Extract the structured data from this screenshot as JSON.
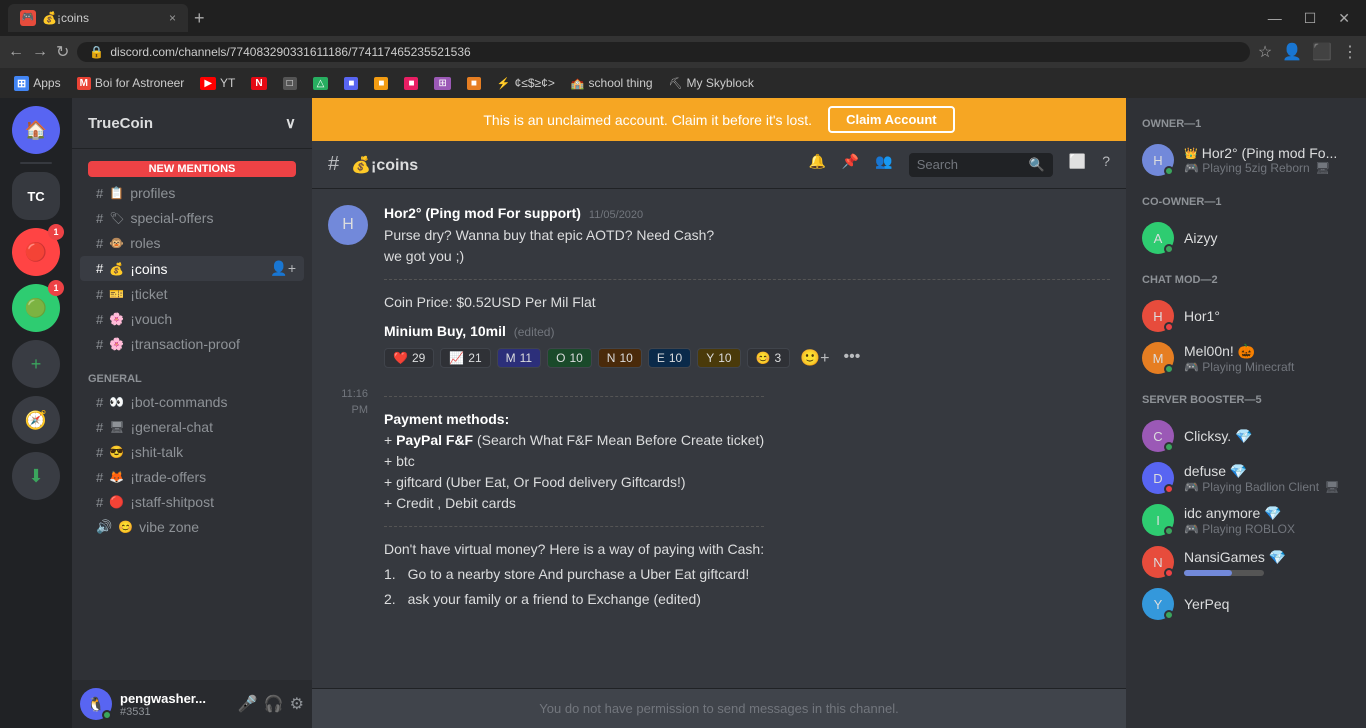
{
  "browser": {
    "tab_favicon": "🎮",
    "tab_title": "💰¡coins",
    "tab_close": "×",
    "nav_back": "←",
    "nav_forward": "→",
    "nav_refresh": "↻",
    "address": "discord.com/channels/774083290331611186/774117465235521536",
    "star_icon": "☆",
    "profile_icon": "👤",
    "menu_icon": "⋮"
  },
  "bookmarks": [
    {
      "label": "Apps",
      "color": "#4285F4",
      "icon": "⋮"
    },
    {
      "label": "Boi for Astroneer",
      "color": "#EA4335",
      "icon": "M"
    },
    {
      "label": "YT",
      "color": "#FF0000",
      "icon": "▶"
    },
    {
      "label": "",
      "color": "#E50914",
      "icon": "N"
    },
    {
      "label": "",
      "color": "#555",
      "icon": "□"
    },
    {
      "label": "",
      "color": "#2ecc71",
      "icon": "△"
    },
    {
      "label": "",
      "color": "#5865F2",
      "icon": "■"
    },
    {
      "label": "",
      "color": "#f39c12",
      "icon": "■"
    },
    {
      "label": "",
      "color": "#e91e63",
      "icon": "■"
    },
    {
      "label": "",
      "color": "#9b59b6",
      "icon": "⊞"
    },
    {
      "label": "",
      "color": "#e67e22",
      "icon": "■"
    },
    {
      "label": "¢≤$≥¢>",
      "color": "#aaa",
      "icon": "⚡"
    },
    {
      "label": "school thing",
      "color": "#aaa",
      "icon": "🏫"
    },
    {
      "label": "My Skyblock",
      "color": "#aaa",
      "icon": "⛏"
    }
  ],
  "server": {
    "name": "TrueCoin",
    "dropdown_icon": "∨"
  },
  "channels": {
    "sections": [
      {
        "name": "",
        "items": [
          {
            "type": "text",
            "name": "profiles",
            "icon": "📋",
            "active": false
          },
          {
            "type": "text",
            "name": "special-offers",
            "icon": "🏷",
            "active": false
          },
          {
            "type": "text",
            "name": "roles",
            "icon": "🐵",
            "active": false
          },
          {
            "type": "text",
            "name": "¡coins",
            "icon": "💰",
            "active": true
          },
          {
            "type": "text",
            "name": "¡ticket",
            "icon": "🎫",
            "active": false
          },
          {
            "type": "text",
            "name": "¡vouch",
            "icon": "🌸",
            "active": false
          },
          {
            "type": "text",
            "name": "¡transaction-proof",
            "icon": "🌸",
            "active": false
          }
        ]
      },
      {
        "name": "GENERAL",
        "items": [
          {
            "type": "text",
            "name": "¡bot-commands",
            "icon": "👀",
            "active": false
          },
          {
            "type": "text",
            "name": "¡general-chat",
            "icon": "🖥",
            "active": false
          },
          {
            "type": "text",
            "name": "¡shit-talk",
            "icon": "😎",
            "active": false
          },
          {
            "type": "text",
            "name": "¡trade-offers",
            "icon": "🦊",
            "active": false
          },
          {
            "type": "text",
            "name": "¡staff-shitpost",
            "icon": "🔴",
            "active": false
          },
          {
            "type": "voice",
            "name": "vibe zone",
            "icon": "😊",
            "active": false
          }
        ]
      }
    ],
    "new_mentions": "NEW MENTIONS"
  },
  "user": {
    "name": "pengwasher...",
    "discriminator": "#3531",
    "avatar_color": "#5865f2",
    "avatar_emoji": "🐧"
  },
  "banner": {
    "text": "This is an unclaimed account. Claim it before it's lost.",
    "button": "Claim Account"
  },
  "channel_header": {
    "hash": "#",
    "name": "💰¡coins",
    "icons": {
      "bell": "🔔",
      "pin": "📌",
      "members": "👥",
      "search_placeholder": "Search",
      "tablet": "⬜",
      "help": "?"
    }
  },
  "messages": [
    {
      "author": "Hor2° (Ping mod For support)",
      "timestamp": "11/05/2020",
      "avatar_color": "#7289da",
      "avatar_emoji": "H",
      "lines": [
        "Purse dry? Wanna buy that epic AOTD? Need Cash?",
        "we got you ;)"
      ],
      "divider": true,
      "coin_price": "Coin Price: $0.52USD Per Mil Flat",
      "min_buy": "Minium Buy, 10mil",
      "min_buy_edited": "(edited)",
      "reactions": [
        {
          "emoji": "❤️",
          "count": "29"
        },
        {
          "emoji": "📈",
          "count": "21"
        },
        {
          "emoji": "M",
          "count": "11",
          "color": "#7289da"
        },
        {
          "emoji": "O",
          "count": "10",
          "color": "#2ecc71"
        },
        {
          "emoji": "N",
          "count": "10",
          "color": "#e67e22"
        },
        {
          "emoji": "E",
          "count": "10",
          "color": "#3498db"
        },
        {
          "emoji": "Y",
          "count": "10",
          "color": "#f1c40f"
        },
        {
          "emoji": "😊",
          "count": "3"
        }
      ],
      "time_label": "11:16 PM",
      "payment_section": {
        "title": "Payment methods:",
        "items": [
          "+ **PayPal F&F** (Search What F&F Mean Before Create ticket)",
          "+ btc",
          "+ giftcard (Uber Eat, Or Food delivery Giftcards!)",
          "+ Credit , Debit cards"
        ]
      },
      "no_virtual": {
        "title": "Don't have virtual money? Here is a way of paying with Cash:",
        "steps": [
          "Go to a nearby store And purchase a Uber Eat giftcard!",
          "ask your family or a friend to Exchange (edited)"
        ]
      }
    }
  ],
  "no_permission": "You do not have permission to send messages in this channel.",
  "members": {
    "sections": [
      {
        "title": "OWNER—1",
        "members": [
          {
            "name": "Hor2° (Ping mod Fo...",
            "sub": "Playing 5zig Reborn",
            "avatar_color": "#7289da",
            "status": "online",
            "has_crown": true,
            "has_badge": false
          }
        ]
      },
      {
        "title": "CO-OWNER—1",
        "members": [
          {
            "name": "Aizyy",
            "sub": "",
            "avatar_color": "#2ecc71",
            "status": "online",
            "has_crown": false,
            "has_badge": false
          }
        ]
      },
      {
        "title": "CHAT MOD—2",
        "members": [
          {
            "name": "Hor1°",
            "sub": "",
            "avatar_color": "#e74c3c",
            "status": "dnd",
            "has_crown": false,
            "has_badge": false
          },
          {
            "name": "Mel00n! 🎃",
            "sub": "Playing Minecraft",
            "avatar_color": "#e67e22",
            "status": "online",
            "has_crown": false,
            "has_badge": false
          }
        ]
      },
      {
        "title": "SERVER BOOSTER—5",
        "members": [
          {
            "name": "Clicksy. 💎",
            "sub": "",
            "avatar_color": "#9b59b6",
            "status": "online",
            "has_crown": false,
            "has_badge": true
          },
          {
            "name": "defuse 💎",
            "sub": "Playing Badlion Client",
            "avatar_color": "#5865f2",
            "status": "dnd",
            "has_crown": false,
            "has_badge": true
          },
          {
            "name": "idc anymore 💎",
            "sub": "Playing ROBLOX",
            "avatar_color": "#2ecc71",
            "status": "online",
            "has_crown": false,
            "has_badge": true
          },
          {
            "name": "NansiGames 💎",
            "sub": "",
            "avatar_color": "#e74c3c",
            "status": "dnd",
            "has_crown": false,
            "has_badge": true
          },
          {
            "name": "YerPeq",
            "sub": "",
            "avatar_color": "#3498db",
            "status": "online",
            "has_crown": false,
            "has_badge": false
          }
        ]
      }
    ]
  }
}
